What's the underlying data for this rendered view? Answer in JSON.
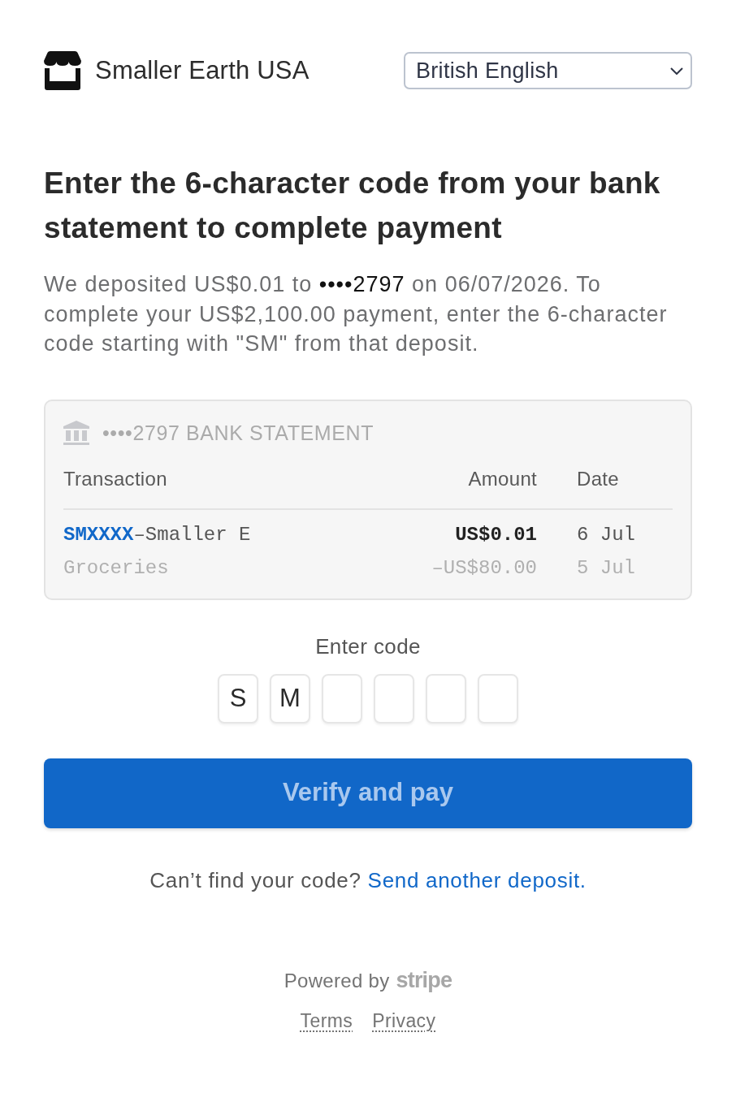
{
  "header": {
    "brand": "Smaller Earth USA",
    "language_select": {
      "value": "British English"
    }
  },
  "heading": "Enter the 6-character code from your bank statement to complete payment",
  "description": {
    "lead": "We deposited US$0.01 to ",
    "account": "••••2797",
    "rest": " on 06/07/2026. To complete your US$2,100.00 payment, enter the 6-character code starting with \"SM\" from that deposit."
  },
  "statement": {
    "title": "••••2797 BANK STATEMENT",
    "columns": [
      "Transaction",
      "Amount",
      "Date"
    ],
    "rows": [
      {
        "code": "SMXXXX",
        "description": "–Smaller E",
        "amount": "US$0.01",
        "date": "6 Jul",
        "highlighted": true
      },
      {
        "description": "Groceries",
        "amount": "–US$80.00",
        "date": "5 Jul",
        "highlighted": false
      }
    ]
  },
  "code_entry": {
    "label": "Enter code",
    "fields": [
      {
        "kind": "filled",
        "value": "S"
      },
      {
        "kind": "filled",
        "value": "M"
      },
      {
        "kind": "empty"
      },
      {
        "kind": "empty"
      },
      {
        "kind": "empty"
      },
      {
        "kind": "empty"
      }
    ]
  },
  "verify_button": {
    "label": "Verify and pay",
    "disabled": true
  },
  "help": {
    "text": "Can’t find your code? ",
    "link": "Send another deposit."
  },
  "footer": {
    "powered_by": "Powered by",
    "logo": "stripe",
    "links": [
      "Terms",
      "Privacy"
    ]
  }
}
